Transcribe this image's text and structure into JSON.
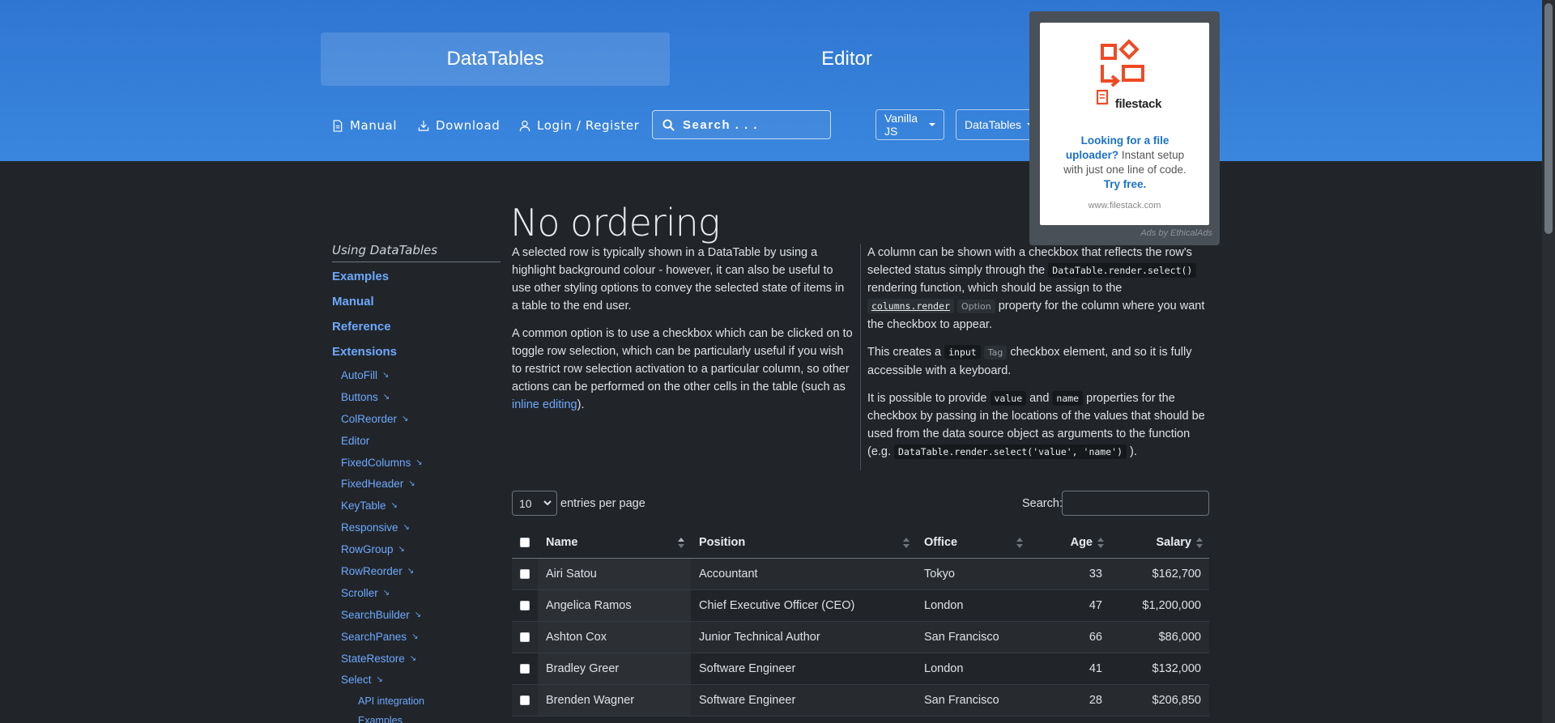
{
  "header": {
    "tabs": [
      {
        "label": "DataTables"
      },
      {
        "label": "Editor"
      }
    ],
    "nav": {
      "manual": "Manual",
      "download": "Download",
      "login": "Login / Register"
    },
    "search_placeholder": "Search . . .",
    "selects": [
      {
        "value": "Vanilla JS"
      },
      {
        "value": "DataTables"
      }
    ]
  },
  "ad": {
    "brand": "filestack",
    "text_highlight": "Looking for a file uploader?",
    "text_body": " Instant setup with just one line of code. ",
    "text_cta": "Try free.",
    "url": "www.filestack.com",
    "attribution": "Ads by EthicalAds"
  },
  "sidebar": {
    "title": "Using DataTables",
    "main_links": [
      "Examples",
      "Manual",
      "Reference",
      "Extensions"
    ],
    "extensions": [
      {
        "label": "AutoFill",
        "arrow": true
      },
      {
        "label": "Buttons",
        "arrow": true
      },
      {
        "label": "ColReorder",
        "arrow": true
      },
      {
        "label": "Editor",
        "arrow": false
      },
      {
        "label": "FixedColumns",
        "arrow": true
      },
      {
        "label": "FixedHeader",
        "arrow": true
      },
      {
        "label": "KeyTable",
        "arrow": true
      },
      {
        "label": "Responsive",
        "arrow": true
      },
      {
        "label": "RowGroup",
        "arrow": true
      },
      {
        "label": "RowReorder",
        "arrow": true
      },
      {
        "label": "Scroller",
        "arrow": true
      },
      {
        "label": "SearchBuilder",
        "arrow": true
      },
      {
        "label": "SearchPanes",
        "arrow": true
      },
      {
        "label": "StateRestore",
        "arrow": true
      },
      {
        "label": "Select",
        "arrow": true
      }
    ],
    "select_sub": [
      "API integration",
      "Examples"
    ],
    "arrow_glyph": "↘"
  },
  "main": {
    "title": "No ordering",
    "left": {
      "p1": "A selected row is typically shown in a DataTable by using a highlight background colour - however, it can also be useful to use other styling options to convey the selected state of items in a table to the end user.",
      "p2a": "A common option is to use a checkbox which can be clicked on to toggle row selection, which can be particularly useful if you wish to restrict row selection activation to a particular column, so other actions can be performed on the other cells in the table (such as ",
      "p2link": "inline editing",
      "p2b": ")."
    },
    "right": {
      "p1a": "A column can be shown with a checkbox that reflects the row's selected status simply through the ",
      "p1code": "DataTable.render.select()",
      "p1b": " rendering function, which should be assign to the ",
      "p1code2": "columns.render",
      "p1tag": "Option",
      "p1c": " property for the column where you want the checkbox to appear.",
      "p2a": "This creates a ",
      "p2code": "input",
      "p2tag": "Tag",
      "p2b": " checkbox element, and so it is fully accessible with a keyboard.",
      "p3a": "It is possible to provide ",
      "p3code1": "value",
      "p3mid": " and ",
      "p3code2": "name",
      "p3b": " properties for the checkbox by passing in the locations of the values that should be used from the data source object as arguments to the function (e.g. ",
      "p3code3": "DataTable.render.select('value', 'name')",
      "p3c": " )."
    }
  },
  "table": {
    "length_value": "10",
    "length_label": "entries per page",
    "search_label": "Search:",
    "columns": [
      "Name",
      "Position",
      "Office",
      "Age",
      "Salary"
    ],
    "rows": [
      [
        "Airi Satou",
        "Accountant",
        "Tokyo",
        "33",
        "$162,700"
      ],
      [
        "Angelica Ramos",
        "Chief Executive Officer (CEO)",
        "London",
        "47",
        "$1,200,000"
      ],
      [
        "Ashton Cox",
        "Junior Technical Author",
        "San Francisco",
        "66",
        "$86,000"
      ],
      [
        "Bradley Greer",
        "Software Engineer",
        "London",
        "41",
        "$132,000"
      ],
      [
        "Brenden Wagner",
        "Software Engineer",
        "San Francisco",
        "28",
        "$206,850"
      ]
    ]
  },
  "colors": {
    "header_blue": "#3a86de",
    "link": "#6ea8fe",
    "background": "#212529",
    "filestack_orange": "#ef4a25"
  }
}
